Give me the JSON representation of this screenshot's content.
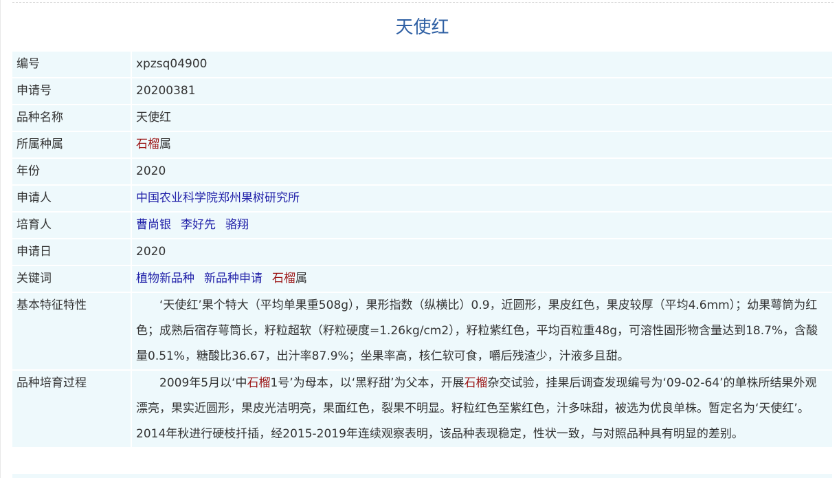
{
  "title": "天使红",
  "rows": {
    "code": {
      "label": "编号",
      "value": "xpzsq04900"
    },
    "app_no": {
      "label": "申请号",
      "value": "20200381"
    },
    "variety_name": {
      "label": "品种名称",
      "value": "天使红"
    },
    "genus": {
      "label": "所属种属",
      "red": "石榴",
      "rest": "属"
    },
    "year": {
      "label": "年份",
      "value": "2020"
    },
    "applicant": {
      "label": "申请人",
      "link": "中国农业科学院郑州果树研究所"
    },
    "breeders": {
      "label": "培育人",
      "names": [
        "曹尚银",
        "李好先",
        "骆翔"
      ]
    },
    "app_date": {
      "label": "申请日",
      "value": "2020"
    },
    "keywords": {
      "label": "关键词",
      "links": [
        "植物新品种",
        "新品种申请"
      ],
      "red": "石榴",
      "rest": "属"
    },
    "features": {
      "label": "基本特征特性",
      "text": "‘天使红’果个特大（平均单果重508g），果形指数（纵横比）0.9，近圆形，果皮红色，果皮较厚（平均4.6mm）；幼果萼筒为红色；成熟后宿存萼筒长，籽粒超软（籽粒硬度=1.26kg/cm2），籽粒紫红色，平均百粒重48g，可溶性固形物含量达到18.7%，含酸量0.51%，糖酸比36.67，出汁率87.9%；坐果率高，核仁软可食，嚼后残渣少，汁液多且甜。"
    },
    "process": {
      "label": "品种培育过程",
      "p1": "2009年5月以‘中",
      "red1": "石榴",
      "p2": "1号’为母本，以‘黑籽甜’为父本，开展",
      "red2": "石榴",
      "p3": "杂交试验，挂果后调查发现编号为‘09-02-64’的单株所结果外观漂亮，果实近圆形，果皮光洁明亮，果面红色，裂果不明显。籽粒红色至紫红色，汁多味甜，被选为优良单株。暂定名为‘天使红’。2014年秋进行硬枝扦插，经2015-2019年连续观察表明，该品种表现稳定，性状一致，与对照品种具有明显的差别。"
    }
  }
}
